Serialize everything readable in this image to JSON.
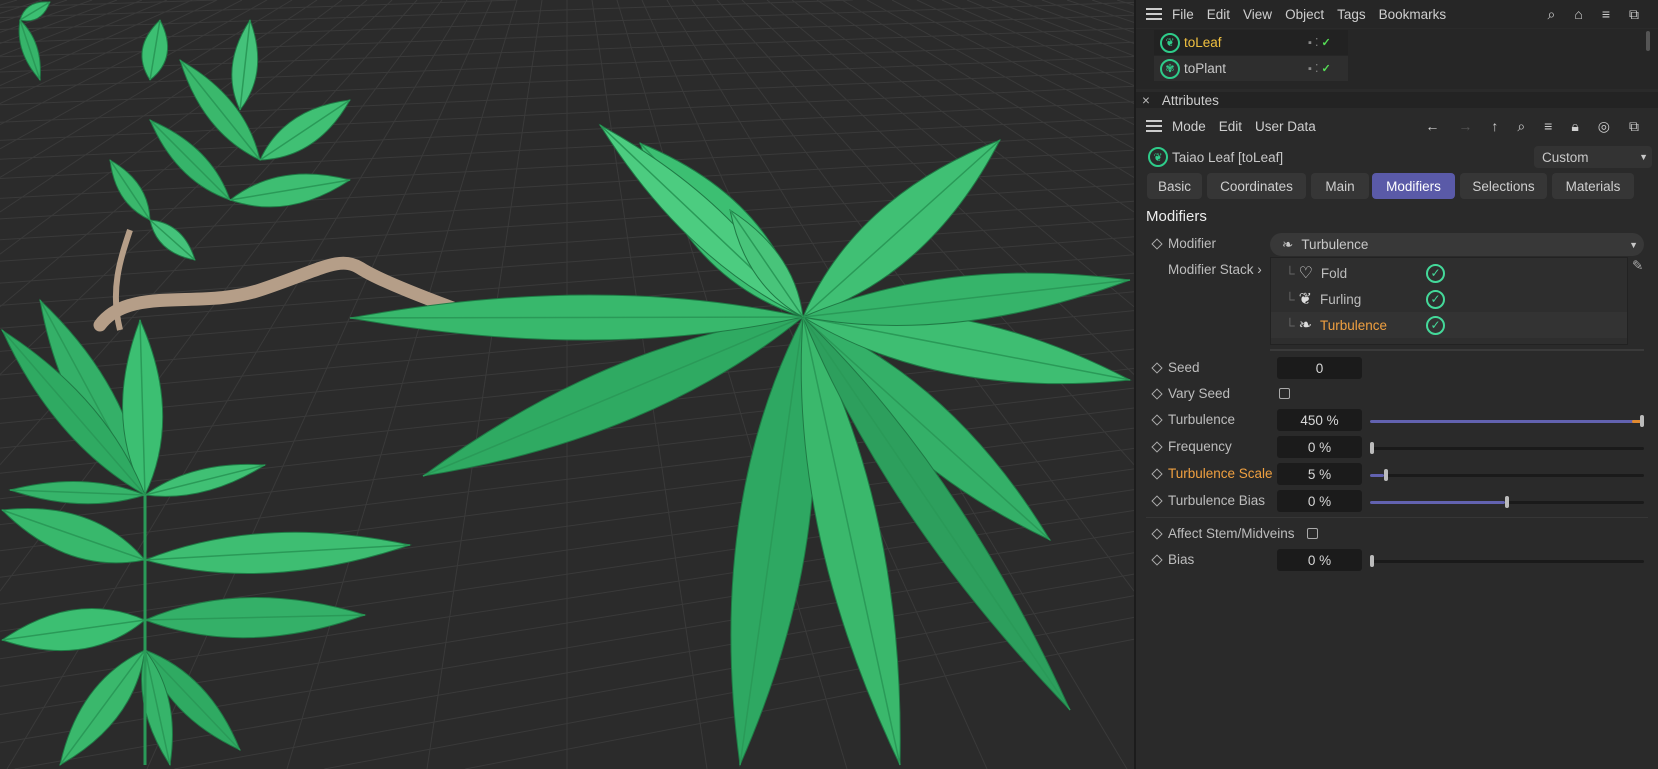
{
  "menu": {
    "items": [
      "File",
      "Edit",
      "View",
      "Object",
      "Tags",
      "Bookmarks"
    ]
  },
  "objects": [
    {
      "name": "toLeaf",
      "selected": true
    },
    {
      "name": "toPlant",
      "selected": false
    }
  ],
  "attributes": {
    "title": "Attributes",
    "close": "×",
    "menu": [
      "Mode",
      "Edit",
      "User Data"
    ],
    "object_title": "Taiao Leaf [toLeaf]",
    "preset": "Custom",
    "tabs": [
      "Basic",
      "Coordinates",
      "Main",
      "Modifiers",
      "Selections",
      "Materials"
    ],
    "active_tab": "Modifiers",
    "section": "Modifiers",
    "modifier_label": "Modifier",
    "modifier_value": "Turbulence",
    "stack_label": "Modifier Stack",
    "stack": [
      {
        "name": "Fold",
        "enabled": true
      },
      {
        "name": "Furling",
        "enabled": true
      },
      {
        "name": "Turbulence",
        "enabled": true,
        "active": true
      }
    ],
    "params": [
      {
        "label": "Seed",
        "value": "0"
      },
      {
        "label": "Vary Seed",
        "checked": false
      },
      {
        "label": "Turbulence",
        "value": "450 %",
        "slider": 1.0
      },
      {
        "label": "Frequency",
        "value": "0 %",
        "slider": 0.0
      },
      {
        "label": "Turbulence Scale",
        "value": "5 %",
        "slider": 0.05,
        "highlight": true
      },
      {
        "label": "Turbulence Bias",
        "value": "0 %",
        "slider": 0.5
      },
      {
        "label": "Affect Stem/Midveins",
        "checked": false
      },
      {
        "label": "Bias",
        "value": "0 %",
        "slider": 0.0
      }
    ]
  },
  "colors": {
    "accent": "#5a5aa8",
    "highlight": "#f0a040",
    "selected_object": "#f0c040",
    "ok": "#44d99a"
  }
}
